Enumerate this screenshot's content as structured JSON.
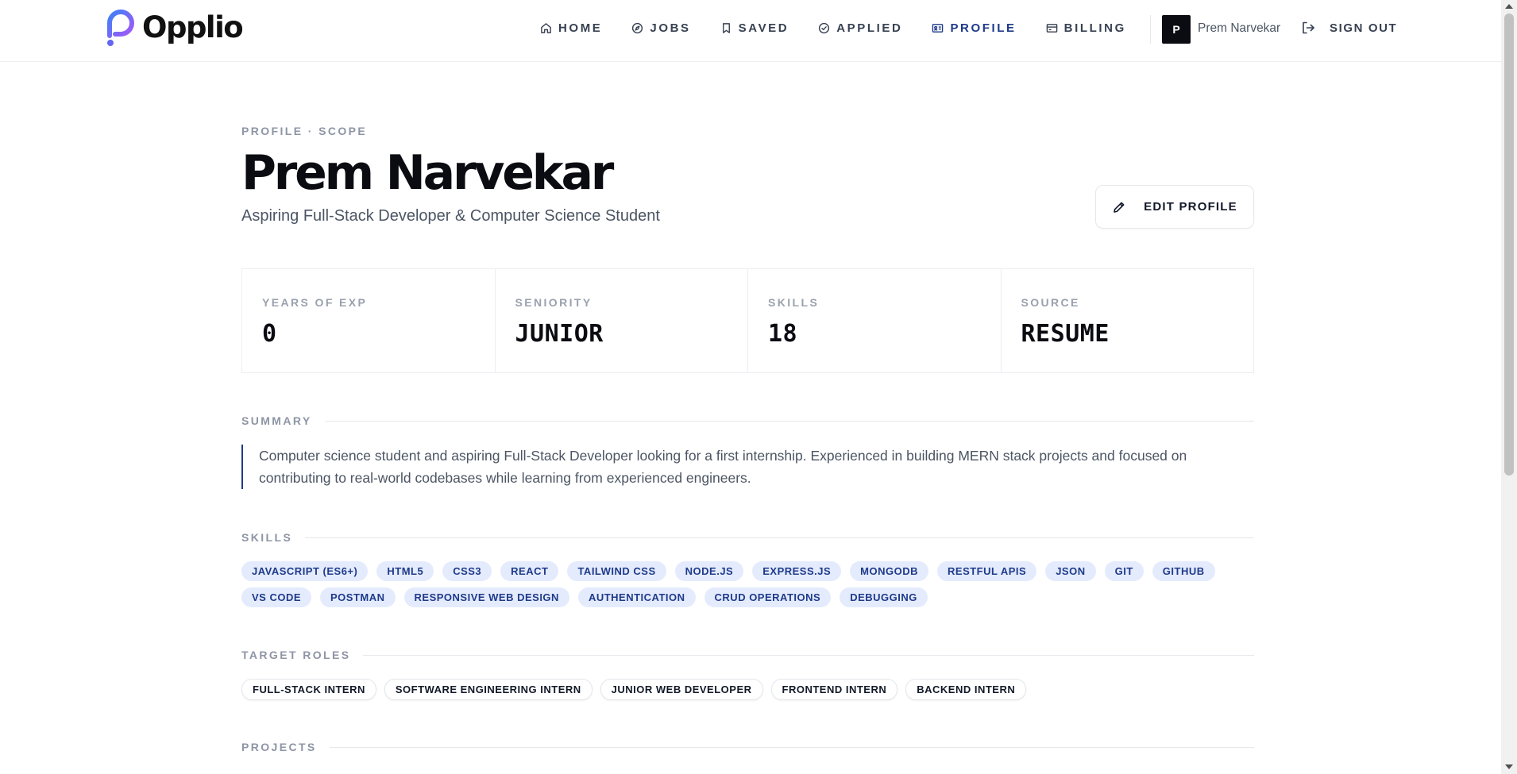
{
  "brand": {
    "name": "Opplio"
  },
  "nav": {
    "items": [
      {
        "label": "HOME",
        "icon": "home-icon"
      },
      {
        "label": "JOBS",
        "icon": "compass-icon"
      },
      {
        "label": "SAVED",
        "icon": "bookmark-icon"
      },
      {
        "label": "APPLIED",
        "icon": "check-circle-icon"
      },
      {
        "label": "PROFILE",
        "icon": "id-card-icon",
        "active": true
      },
      {
        "label": "BILLING",
        "icon": "credit-card-icon"
      }
    ],
    "active_color": "#1e3a8a"
  },
  "user": {
    "initial": "P",
    "name": "Prem Narvekar",
    "signout_label": "SIGN OUT"
  },
  "profile": {
    "eyebrow": "PROFILE · SCOPE",
    "name": "Prem Narvekar",
    "headline": "Aspiring Full-Stack Developer & Computer Science Student",
    "edit_label": "EDIT PROFILE"
  },
  "stats": [
    {
      "label": "YEARS OF EXP",
      "value": "0"
    },
    {
      "label": "SENIORITY",
      "value": "JUNIOR"
    },
    {
      "label": "SKILLS",
      "value": "18"
    },
    {
      "label": "SOURCE",
      "value": "RESUME"
    }
  ],
  "sections": {
    "summary": {
      "label": "SUMMARY",
      "text": "Computer science student and aspiring Full-Stack Developer looking for a first internship. Experienced in building MERN stack projects and focused on contributing to real-world codebases while learning from experienced engineers."
    },
    "skills": {
      "label": "SKILLS",
      "items": [
        "JAVASCRIPT (ES6+)",
        "HTML5",
        "CSS3",
        "REACT",
        "TAILWIND CSS",
        "NODE.JS",
        "EXPRESS.JS",
        "MONGODB",
        "RESTFUL APIS",
        "JSON",
        "GIT",
        "GITHUB",
        "VS CODE",
        "POSTMAN",
        "RESPONSIVE WEB DESIGN",
        "AUTHENTICATION",
        "CRUD OPERATIONS",
        "DEBUGGING"
      ]
    },
    "target_roles": {
      "label": "TARGET ROLES",
      "items": [
        "FULL-STACK INTERN",
        "SOFTWARE ENGINEERING INTERN",
        "JUNIOR WEB DEVELOPER",
        "FRONTEND INTERN",
        "BACKEND INTERN"
      ]
    },
    "projects": {
      "label": "PROJECTS"
    }
  },
  "colors": {
    "accent": "#1e3a8a",
    "chip_bg": "#e4ebfd",
    "logo_gradient": [
      "#3b82f6",
      "#a855f7"
    ]
  }
}
